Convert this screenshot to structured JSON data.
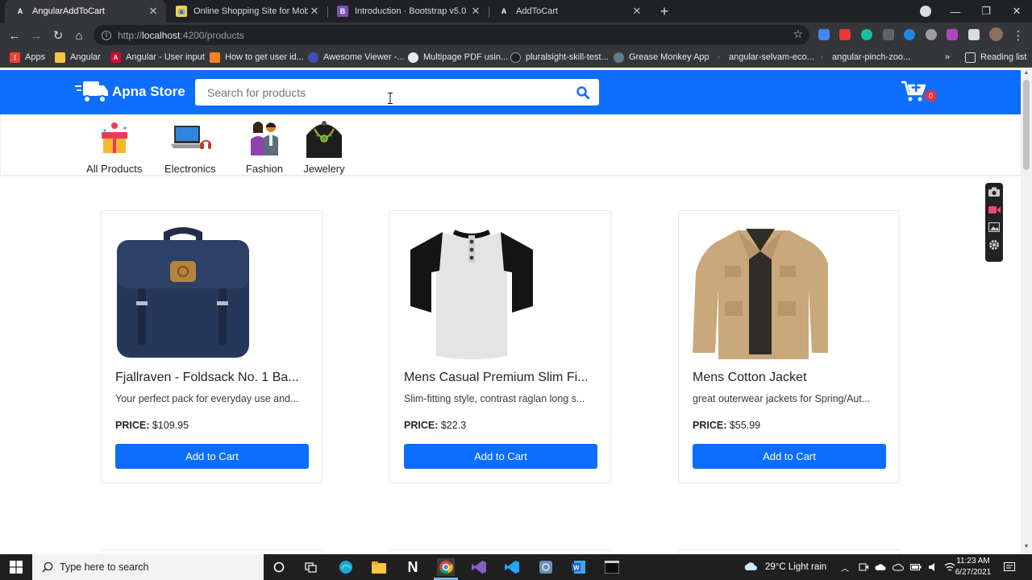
{
  "browser": {
    "tabs": [
      {
        "title": "AngularAddToCart",
        "favicon": "angular-icon",
        "active": true
      },
      {
        "title": "Online Shopping Site for Mobile",
        "favicon": "shopping-icon",
        "active": false
      },
      {
        "title": "Introduction · Bootstrap v5.0",
        "favicon": "bootstrap-icon",
        "active": false
      },
      {
        "title": "AddToCart",
        "favicon": "angular-icon",
        "active": false
      }
    ],
    "url_prefix": "http://",
    "url_host": "localhost",
    "url_path": ":4200/products",
    "bookmarks": [
      {
        "label": "Apps",
        "icon": "apps-grid-icon"
      },
      {
        "label": "Angular",
        "icon": "folder-icon"
      },
      {
        "label": "Angular - User input",
        "icon": "angular-icon"
      },
      {
        "label": "How to get user id...",
        "icon": "stackoverflow-icon"
      },
      {
        "label": "Awesome Viewer -...",
        "icon": "viewer-icon"
      },
      {
        "label": "Multipage PDF usin...",
        "icon": "github-icon"
      },
      {
        "label": "pluralsight-skill-test...",
        "icon": "github-icon"
      },
      {
        "label": "Grease Monkey App",
        "icon": "gear-icon"
      },
      {
        "label": "angular-selvam-eco...",
        "icon": "stackblitz-icon"
      },
      {
        "label": "angular-pinch-zoo...",
        "icon": "stackblitz-icon"
      }
    ],
    "more_bookmarks": "»",
    "reading_list": "Reading list"
  },
  "store": {
    "brand": "Apna Store",
    "search_placeholder": "Search for products",
    "cart_count": "0",
    "accent": "#0d6efd",
    "categories": [
      {
        "label": "All Products",
        "icon": "gift-box-icon"
      },
      {
        "label": "Electronics",
        "icon": "laptop-headphones-icon"
      },
      {
        "label": "Fashion",
        "icon": "fashion-couple-icon"
      },
      {
        "label": "Jewelery",
        "icon": "necklace-icon"
      }
    ],
    "products": [
      {
        "title": "Fjallraven - Foldsack No. 1 Ba...",
        "description": "Your perfect pack for everyday use and...",
        "price_label": "PRICE:",
        "price": "$109.95",
        "button": "Add to Cart",
        "image": "backpack-image"
      },
      {
        "title": "Mens Casual Premium Slim Fi...",
        "description": "Slim-fitting style, contrast raglan long s...",
        "price_label": "PRICE:",
        "price": "$22.3",
        "button": "Add to Cart",
        "image": "tshirt-image"
      },
      {
        "title": "Mens Cotton Jacket",
        "description": "great outerwear jackets for Spring/Aut...",
        "price_label": "PRICE:",
        "price": "$55.99",
        "button": "Add to Cart",
        "image": "jacket-image"
      }
    ]
  },
  "taskbar": {
    "search_placeholder": "Type here to search",
    "weather": "29°C  Light rain",
    "time": "11:23 AM",
    "date": "6/27/2021"
  }
}
